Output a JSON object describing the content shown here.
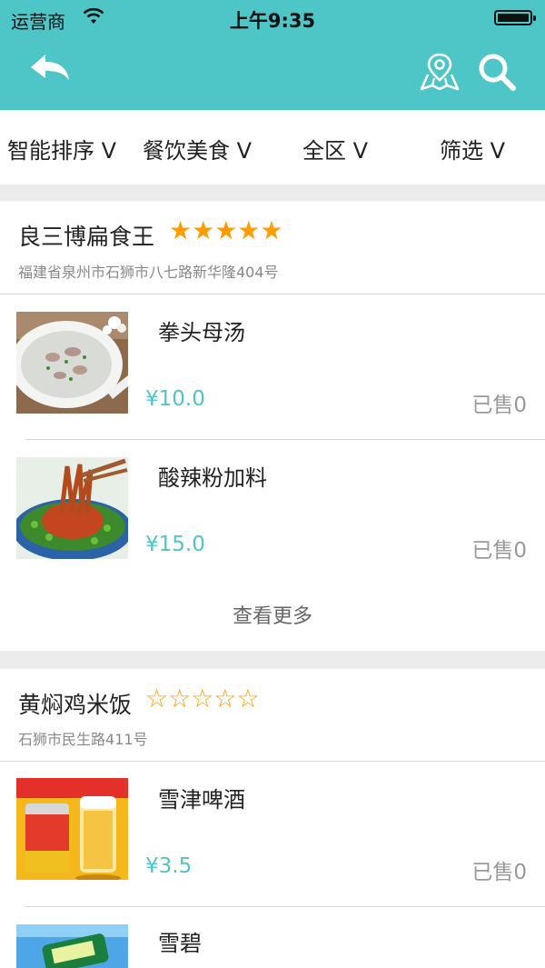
{
  "status_bar": {
    "carrier": "运营商",
    "time": "上午9:35"
  },
  "nav": {
    "back_icon": "back-arrow-icon",
    "map_icon": "map-location-icon",
    "search_icon": "search-icon"
  },
  "colors": {
    "brand": "#4ec5c7",
    "star": "#ff9c00",
    "price": "#4ec5c7"
  },
  "filters": [
    "智能排序 V",
    "餐饮美食 V",
    "全区 V",
    "筛选 V"
  ],
  "shops": [
    {
      "name": "良三博扁食王",
      "stars": "★★★★★",
      "address": "福建省泉州市石狮市八七路新华隆404号",
      "items": [
        {
          "name": "拳头母汤",
          "price": "¥10.0",
          "sold": "已售0"
        },
        {
          "name": "酸辣粉加料",
          "price": "¥15.0",
          "sold": "已售0"
        }
      ],
      "more_label": "查看更多"
    },
    {
      "name": "黄焖鸡米饭",
      "stars": "☆☆☆☆☆",
      "address": "石狮市民生路411号",
      "items": [
        {
          "name": "雪津啤酒",
          "price": "¥3.5",
          "sold": "已售0"
        },
        {
          "name": "雪碧"
        }
      ]
    }
  ]
}
